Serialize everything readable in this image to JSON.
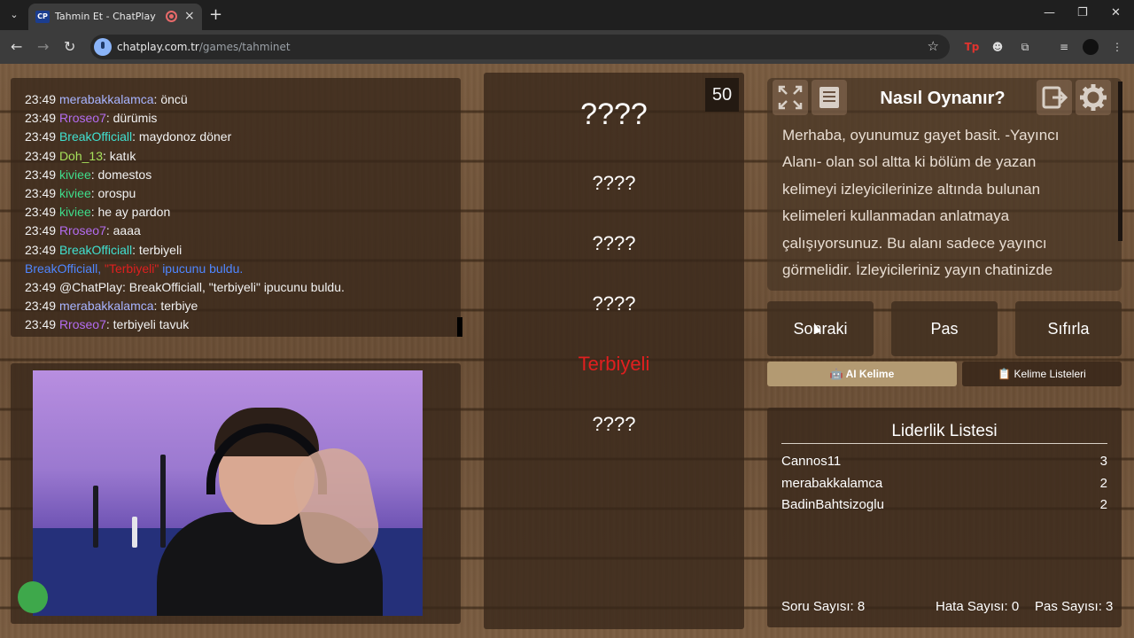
{
  "browser": {
    "tab_favicon": "CP",
    "tab_title": "Tahmin Et - ChatPlay",
    "url_host": "chatplay.com.tr",
    "url_path": "/games/tahminet"
  },
  "chat": {
    "messages": [
      {
        "time": "23:49",
        "user": "merabakkalamca",
        "user_color": "#a8b4ff",
        "text": ": öncü"
      },
      {
        "time": "23:49",
        "user": "Rroseo7",
        "user_color": "#b36cf0",
        "text": ": dürümis"
      },
      {
        "time": "23:49",
        "user": "BreakOfficiall",
        "user_color": "#40e0d0",
        "text": ": maydonoz döner"
      },
      {
        "time": "23:49",
        "user": "Doh_13",
        "user_color": "#a6e05a",
        "text": ": katık"
      },
      {
        "time": "23:49",
        "user": "kiviee",
        "user_color": "#3fdc8a",
        "text": ": domestos"
      },
      {
        "time": "23:49",
        "user": "kiviee",
        "user_color": "#3fdc8a",
        "text": ": orospu"
      },
      {
        "time": "23:49",
        "user": "kiviee",
        "user_color": "#3fdc8a",
        "text": ": he ay pardon"
      },
      {
        "time": "23:49",
        "user": "Rroseo7",
        "user_color": "#b36cf0",
        "text": ": aaaa"
      },
      {
        "time": "23:49",
        "user": "BreakOfficiall",
        "user_color": "#40e0d0",
        "text": ": terbiyeli"
      },
      {
        "system": true,
        "user": "BreakOfficiall,",
        "word": " \"Terbiyeli\" ",
        "suffix": "ipucunu buldu."
      },
      {
        "time": "23:49",
        "user": "@ChatPlay",
        "user_color": "#f2f2f2",
        "text": ": BreakOfficiall, \"terbiyeli\" ipucunu buldu."
      },
      {
        "time": "23:49",
        "user": "merabakkalamca",
        "user_color": "#a8b4ff",
        "text": ": terbiye"
      },
      {
        "time": "23:49",
        "user": "Rroseo7",
        "user_color": "#b36cf0",
        "text": ": terbiyeli tavuk"
      }
    ]
  },
  "game": {
    "counter": "50",
    "main_word": "????",
    "hints": [
      {
        "text": "????",
        "found": false
      },
      {
        "text": "????",
        "found": false
      },
      {
        "text": "????",
        "found": false
      },
      {
        "text": "Terbiyeli",
        "found": true
      },
      {
        "text": "????",
        "found": false
      }
    ]
  },
  "howto": {
    "title": "Nasıl Oynanır?",
    "text": "Merhaba, oyunumuz gayet basit. -Yayıncı Alanı- olan sol altta ki bölüm de yazan kelimeyi izleyicilerinize altında bulunan kelimeleri kullanmadan anlatmaya çalışıyorsunuz. Bu alanı sadece yayıncı görmelidir. İzleyicileriniz yayın chatinizde",
    "icons": [
      "fullscreen-icon",
      "document-icon",
      "exit-icon",
      "gear-icon"
    ]
  },
  "controls": {
    "next_label": "Sonraki",
    "pass_label": "Pas",
    "reset_label": "Sıfırla",
    "ai_tab_label": "🤖 AI Kelime",
    "lists_tab_label": "📋 Kelime Listeleri"
  },
  "leaderboard": {
    "title": "Liderlik Listesi",
    "rows": [
      {
        "name": "Cannos11",
        "score": "3"
      },
      {
        "name": "merabakkalamca",
        "score": "2"
      },
      {
        "name": "BadinBahtsizoglu",
        "score": "2"
      }
    ],
    "question_count": "Soru Sayısı: 8",
    "error_count": "Hata Sayısı: 0",
    "pass_count": "Pas Sayısı: 3"
  }
}
